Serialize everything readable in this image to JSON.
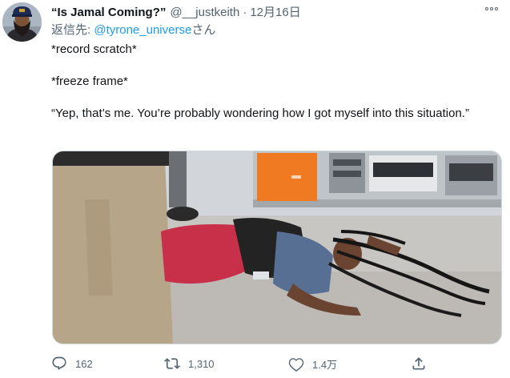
{
  "tweet": {
    "display_name": "“Is Jamal Coming?”",
    "handle": "@__justkeith",
    "separator": "·",
    "date": "12月16日",
    "reply_prefix": "返信先: ",
    "reply_handle": "@tyrone_universe",
    "reply_suffix": "さん",
    "text_lines": [
      "*record scratch*",
      "*freeze frame*",
      "“Yep, that’s me. You’re probably wondering how I got myself into this situation.”"
    ],
    "media": {
      "icon": "photo-icon"
    },
    "actions": {
      "reply": {
        "icon": "reply-icon",
        "count": "162"
      },
      "retweet": {
        "icon": "retweet-icon",
        "count": "1,310"
      },
      "like": {
        "icon": "heart-icon",
        "count": "1.4万"
      },
      "share": {
        "icon": "share-icon"
      }
    },
    "more": {
      "icon": "more-icon"
    }
  },
  "colors": {
    "text": "#0f1419",
    "secondary": "#536471",
    "link": "#1d9bf0",
    "border": "#cfd9de"
  }
}
